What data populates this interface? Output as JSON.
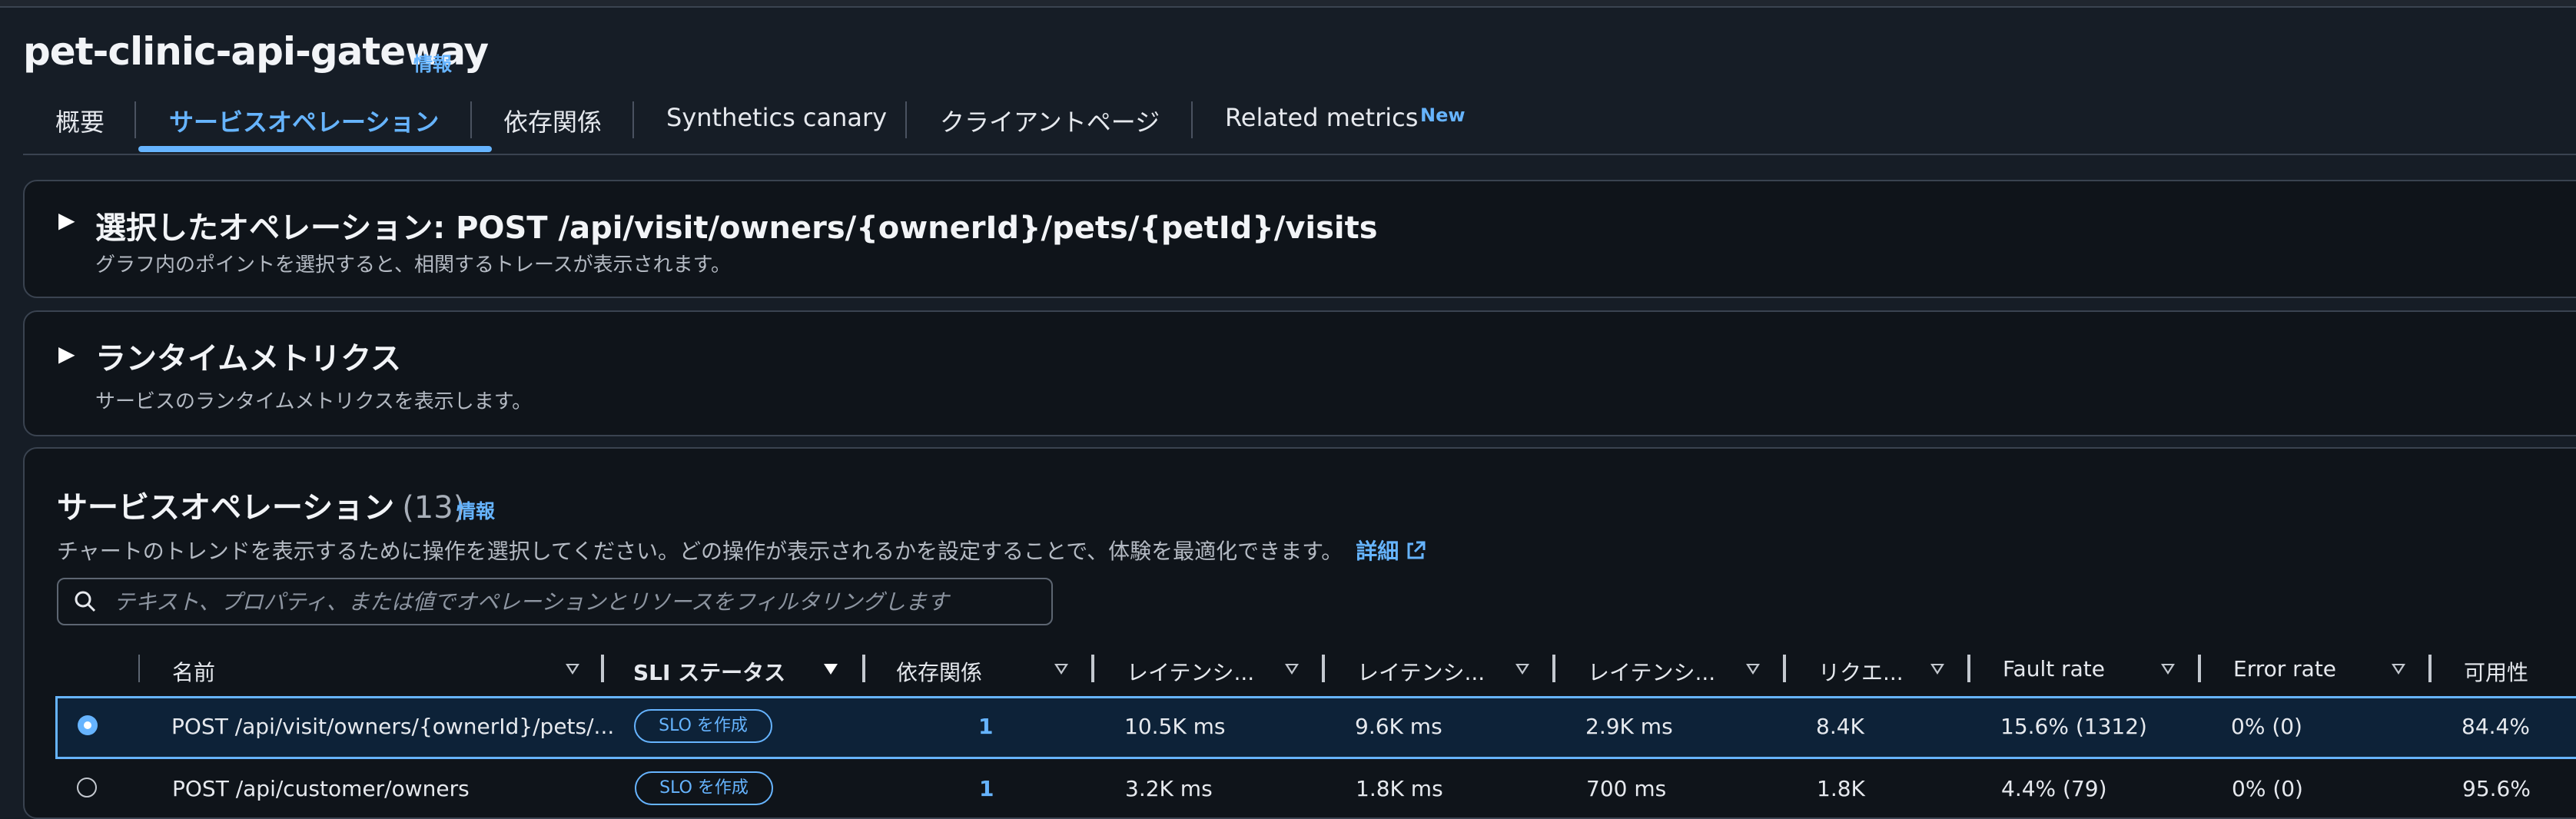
{
  "service": {
    "name": "pet-clinic-api-gateway",
    "info": "情報"
  },
  "tabs": [
    {
      "label": "概要"
    },
    {
      "label": "サービスオペレーション"
    },
    {
      "label": "依存関係"
    },
    {
      "label": "Synthetics canary"
    },
    {
      "label": "クライアントページ"
    },
    {
      "label": "Related metrics",
      "badge": "New"
    }
  ],
  "selected_panel": {
    "title": "選択したオペレーション: POST /api/visit/owners/{ownerId}/pets/{petId}/visits",
    "description": "グラフ内のポイントを選択すると、相関するトレースが表示されます。"
  },
  "runtime_panel": {
    "title": "ランタイムメトリクス",
    "description": "サービスのランタイムメトリクスを表示します。"
  },
  "operations": {
    "title": "サービスオペレーション",
    "count": "(13)",
    "info": "情報",
    "description": "チャートのトレンドを表示するために操作を選択してください。どの操作が表示されるかを設定することで、体験を最適化できます。",
    "learn_more": "詳細",
    "search_placeholder": "テキスト、プロパティ、または値でオペレーションとリソースをフィルタリングします",
    "columns": [
      "名前",
      "SLI ステータス",
      "依存関係",
      "レイテンシ...",
      "レイテンシ...",
      "レイテンシ...",
      "リクエ...",
      "Fault rate",
      "Error rate",
      "可用性"
    ],
    "rows": [
      {
        "name": "POST /api/visit/owners/{ownerId}/pets/...",
        "slo": "SLO を作成",
        "deps": "1",
        "lat1": "10.5K ms",
        "lat2": "9.6K ms",
        "lat3": "2.9K ms",
        "requests": "8.4K",
        "fault": "15.6% (1312)",
        "error": "0% (0)",
        "availability": "84.4%",
        "selected": true
      },
      {
        "name": "POST /api/customer/owners",
        "slo": "SLO を作成",
        "deps": "1",
        "lat1": "3.2K ms",
        "lat2": "1.8K ms",
        "lat3": "700 ms",
        "requests": "1.8K",
        "fault": "4.4% (79)",
        "error": "0% (0)",
        "availability": "95.6%",
        "selected": false
      }
    ]
  },
  "colors": {
    "accent": "#66b4ff",
    "background": "#161d26",
    "panel": "#0f141a"
  }
}
